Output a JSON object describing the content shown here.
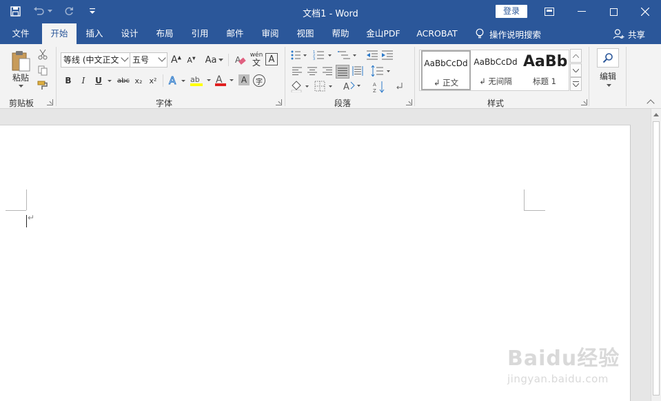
{
  "window": {
    "title": "文档1  -  Word",
    "login_label": "登录"
  },
  "tabs": [
    {
      "label": "文件"
    },
    {
      "label": "开始"
    },
    {
      "label": "插入"
    },
    {
      "label": "设计"
    },
    {
      "label": "布局"
    },
    {
      "label": "引用"
    },
    {
      "label": "邮件"
    },
    {
      "label": "审阅"
    },
    {
      "label": "视图"
    },
    {
      "label": "帮助"
    },
    {
      "label": "金山PDF"
    },
    {
      "label": "ACROBAT"
    }
  ],
  "active_tab": "开始",
  "tell_me": "操作说明搜索",
  "share": "共享",
  "ribbon": {
    "clipboard": {
      "label": "剪贴板",
      "paste": "粘贴"
    },
    "font": {
      "label": "字体",
      "font_name": "等线 (中文正文",
      "font_size": "五号",
      "bold": "B",
      "italic": "I",
      "underline": "U",
      "strike": "abc",
      "subscript": "x₂",
      "superscript": "x²",
      "change_case": "Aa",
      "phonetic": "wén",
      "phonetic_char": "文",
      "border_char": "A",
      "enclose_char": "字"
    },
    "paragraph": {
      "label": "段落"
    },
    "styles": {
      "label": "样式",
      "items": [
        {
          "sample": "AaBbCcDd",
          "name": "↲ 正文"
        },
        {
          "sample": "AaBbCcDd",
          "name": "↲ 无间隔"
        },
        {
          "sample": "AaBb",
          "name": "标题 1"
        }
      ]
    },
    "editing": {
      "label": "编辑"
    }
  },
  "document": {
    "para_mark": "↵"
  },
  "watermark": {
    "logo": "Baidu经验",
    "url": "jingyan.baidu.com"
  },
  "colors": {
    "accent": "#2b579a",
    "highlight": "#ffff00",
    "font_color": "#e02020"
  }
}
